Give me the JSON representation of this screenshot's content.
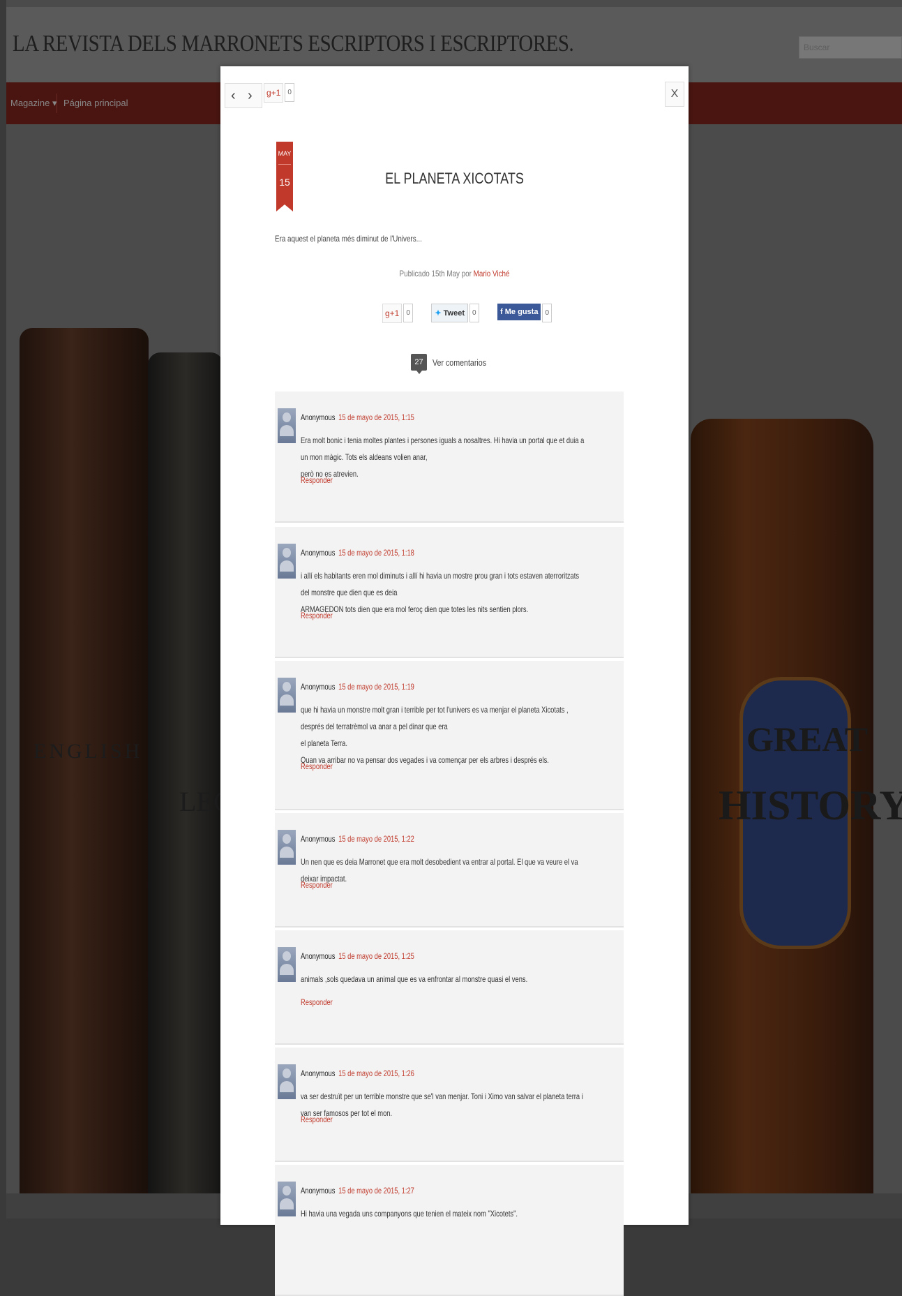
{
  "site": {
    "title": "LA REVISTA DELS MARRONETS ESCRIPTORS I ESCRIPTORES.",
    "search_placeholder": "Buscar"
  },
  "nav": {
    "items": [
      {
        "label": "Magazine",
        "dropdown": "▾"
      },
      {
        "label": "Página principal"
      }
    ]
  },
  "background_books": {
    "spine_1": "ENGLISH",
    "spine_2": "LEG",
    "spine_3_top": "GREAT",
    "spine_3_bottom": "HISTORY"
  },
  "modal": {
    "prev_icon": "‹",
    "next_icon": "›",
    "gplus_label": "g+1",
    "gplus_count": "0",
    "close_label": "X",
    "date": {
      "month": "MAY",
      "day": "15"
    },
    "post_title": "EL PLANETA XICOTATS",
    "excerpt": "Era aquest el planeta més diminut de l'Univers...",
    "byline": {
      "prefix": "Publicado 15th May por",
      "author": "Mario Viché"
    },
    "share": {
      "gplus_label": "g+1",
      "gplus_count": "0",
      "tweet_label": "Tweet",
      "tweet_count": "0",
      "fb_label": "Me gusta",
      "fb_count": "0"
    },
    "comments_count": "27",
    "comments_toggle": "Ver comentarios",
    "reply_label": "Responder",
    "comments": [
      {
        "author": "Anonymous",
        "date": "15 de mayo de 2015, 1:15",
        "lines": [
          "Era molt bonic i tenia moltes plantes i persones iguals a nosaltres. Hi havia un portal que et duia a un mon màgic. Tots els aldeans volien anar,",
          "però no es atrevien."
        ]
      },
      {
        "author": "Anonymous",
        "date": "15 de mayo de 2015, 1:18",
        "lines": [
          "i allí els habitants eren mol diminuts i allí hi havia un mostre prou gran i tots estaven aterroritzats del monstre que dien que es deia",
          "ARMAGEDON tots dien que era mol feroç dien que totes les nits sentien plors."
        ]
      },
      {
        "author": "Anonymous",
        "date": "15 de mayo de 2015, 1:19",
        "lines": [
          "que hi havia un monstre molt gran i terrible per tot l'univers es va menjar el planeta Xicotats , després del terratrèmol va anar a pel dinar que era",
          "el planeta Terra.",
          "Quan va arribar no va pensar dos vegades i va començar per els arbres i després els."
        ]
      },
      {
        "author": "Anonymous",
        "date": "15 de mayo de 2015, 1:22",
        "lines": [
          "Un nen que es deia Marronet que era molt desobedient va entrar al portal. El que va veure el va deixar impactat."
        ]
      },
      {
        "author": "Anonymous",
        "date": "15 de mayo de 2015, 1:25",
        "lines": [
          "animals ,sols quedava un animal que es va enfrontar al monstre quasi el vens."
        ]
      },
      {
        "author": "Anonymous",
        "date": "15 de mayo de 2015, 1:26",
        "lines": [
          "va ser destruït per un terrible monstre que se'l van menjar. Toni i Ximo van salvar el planeta terra i van ser famosos per tot el mon."
        ]
      },
      {
        "author": "Anonymous",
        "date": "15 de mayo de 2015, 1:27",
        "lines": [
          "Hi havia una vegada uns companyons que tenien el mateix nom \"Xicotets\"."
        ]
      }
    ]
  }
}
